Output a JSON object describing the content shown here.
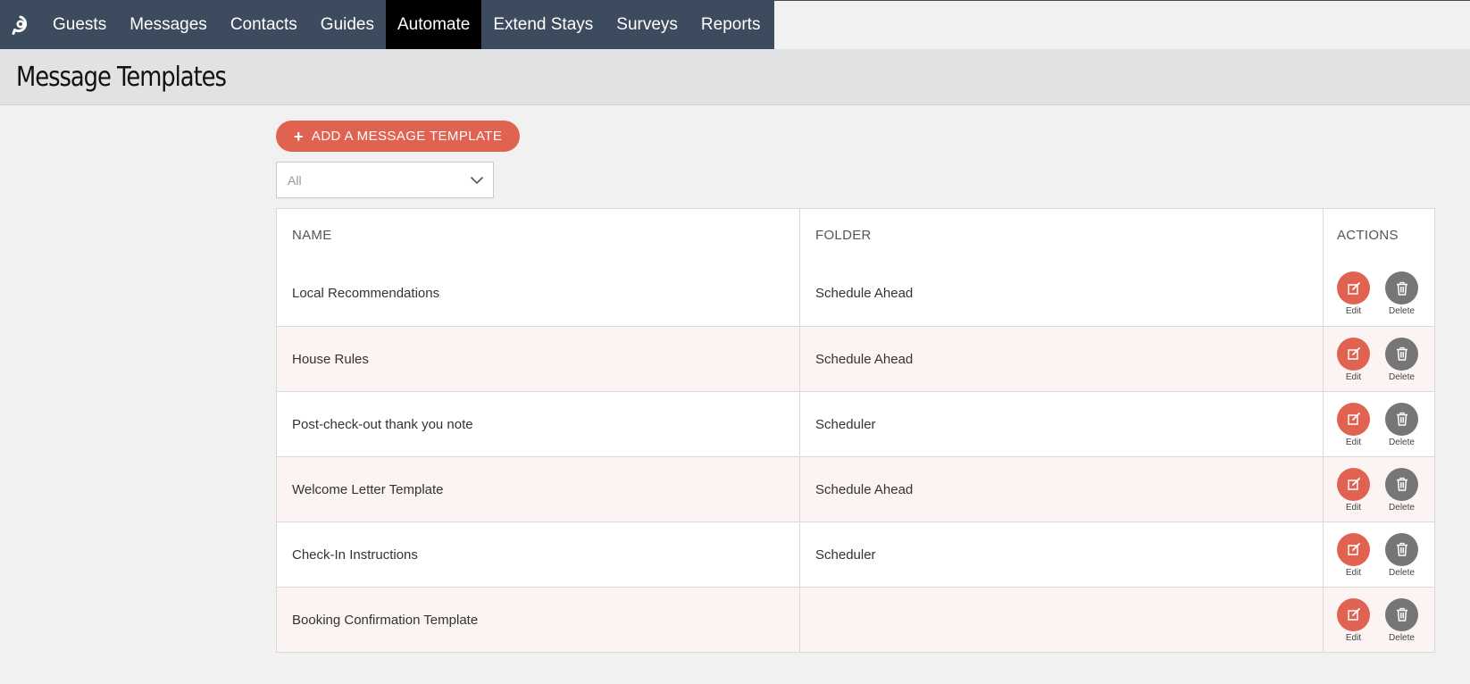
{
  "nav": {
    "items": [
      {
        "label": "Guests",
        "active": false
      },
      {
        "label": "Messages",
        "active": false
      },
      {
        "label": "Contacts",
        "active": false
      },
      {
        "label": "Guides",
        "active": false
      },
      {
        "label": "Automate",
        "active": true
      },
      {
        "label": "Extend Stays",
        "active": false
      },
      {
        "label": "Surveys",
        "active": false
      },
      {
        "label": "Reports",
        "active": false
      }
    ]
  },
  "page": {
    "title": "Message Templates"
  },
  "toolbar": {
    "add_label": "ADD A MESSAGE TEMPLATE"
  },
  "filter": {
    "value": "All"
  },
  "table": {
    "headers": {
      "name": "NAME",
      "folder": "FOLDER",
      "actions": "ACTIONS"
    },
    "rows": [
      {
        "name": "Local Recommendations",
        "folder": "Schedule Ahead"
      },
      {
        "name": "House Rules",
        "folder": "Schedule Ahead"
      },
      {
        "name": "Post-check-out thank you note",
        "folder": "Scheduler"
      },
      {
        "name": "Welcome Letter Template",
        "folder": "Schedule Ahead"
      },
      {
        "name": "Check-In Instructions",
        "folder": "Scheduler"
      },
      {
        "name": "Booking Confirmation Template",
        "folder": ""
      }
    ],
    "edit_label": "Edit",
    "delete_label": "Delete"
  },
  "colors": {
    "nav_bg": "#3d4b5e",
    "active_nav": "#000000",
    "accent": "#e06352",
    "delete": "#767676",
    "alt_row": "#fbf4f3"
  },
  "icons": {
    "logo": "logo-icon",
    "add": "plus-icon",
    "dropdown": "chevron-down-icon",
    "edit": "edit-icon",
    "delete": "trash-icon"
  }
}
